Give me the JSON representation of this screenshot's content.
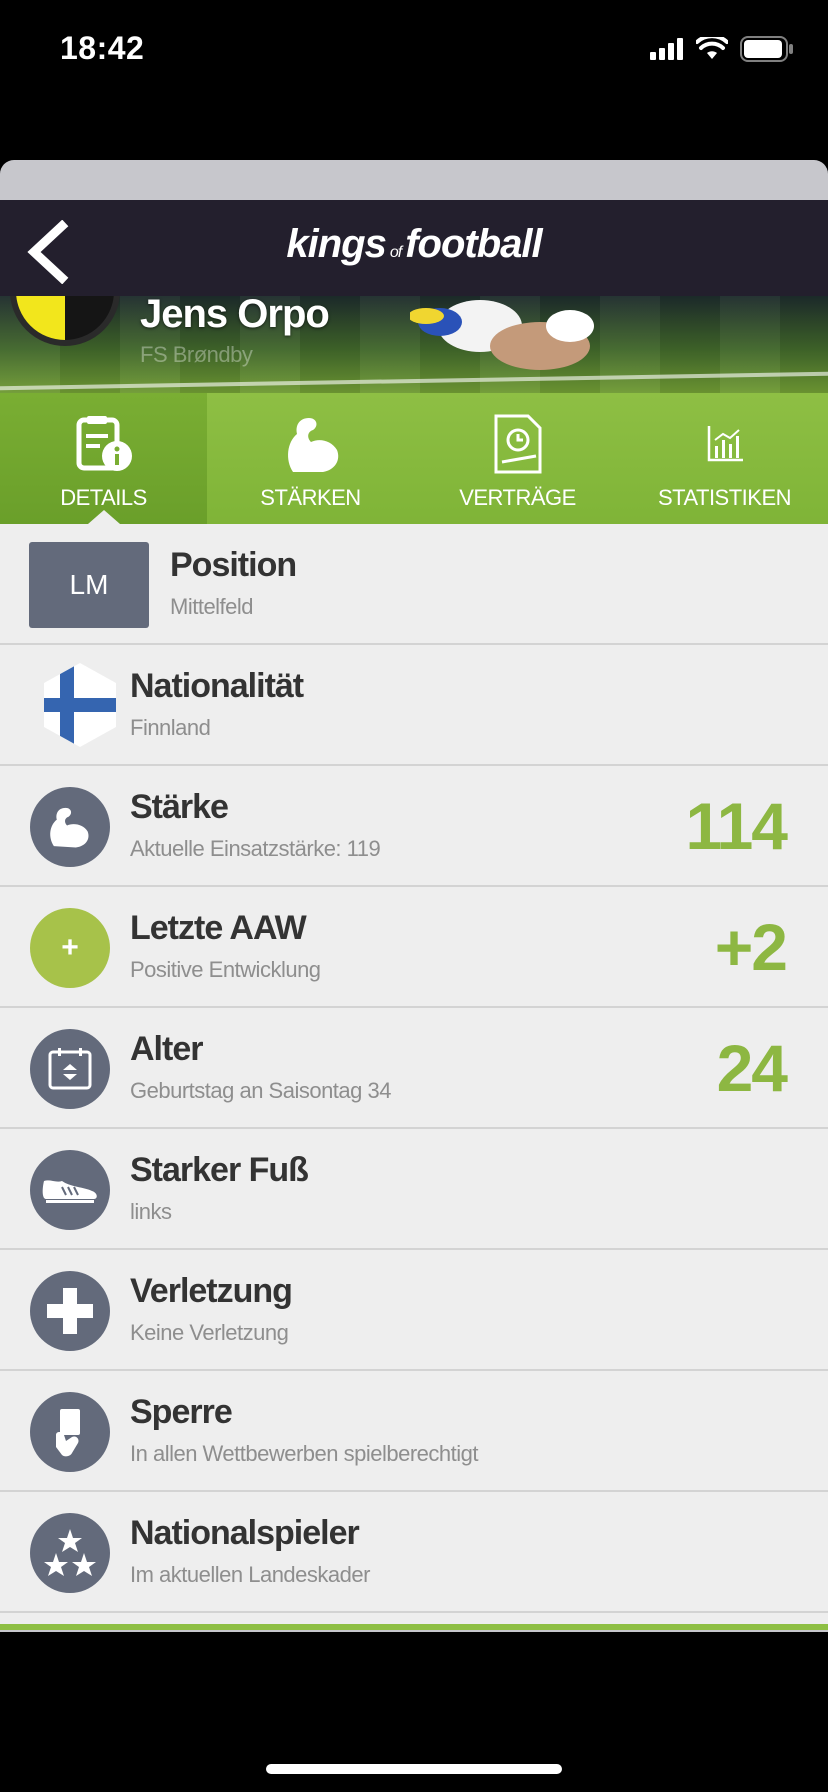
{
  "status": {
    "time": "18:42"
  },
  "app": {
    "logo_left": "kings",
    "logo_of": "of",
    "logo_right": "football"
  },
  "player": {
    "name": "Jens Orpo",
    "club": "FS Brøndby"
  },
  "tabs": [
    {
      "label": "DETAILS",
      "icon": "document-info-icon",
      "active": true
    },
    {
      "label": "STÄRKEN",
      "icon": "muscle-arm-icon"
    },
    {
      "label": "VERTRÄGE",
      "icon": "contract-clock-icon"
    },
    {
      "label": "STATISTIKEN",
      "icon": "bar-chart-icon"
    }
  ],
  "details": {
    "position": {
      "badge": "LM",
      "title": "Position",
      "subtitle": "Mittelfeld"
    },
    "nationality": {
      "title": "Nationalität",
      "subtitle": "Finnland",
      "icon": "finland-flag-icon"
    },
    "strength": {
      "title": "Stärke",
      "subtitle": "Aktuelle Einsatzstärke: 119",
      "value": "114",
      "icon": "muscle-arm-icon"
    },
    "last_aaw": {
      "title": "Letzte AAW",
      "subtitle": "Positive Entwicklung",
      "value": "+2",
      "icon_text": "+"
    },
    "age": {
      "title": "Alter",
      "subtitle": "Geburtstag an Saisontag 34",
      "value": "24",
      "icon": "calendar-icon"
    },
    "foot": {
      "title": "Starker Fuß",
      "subtitle": "links",
      "icon": "football-boot-icon"
    },
    "injury": {
      "title": "Verletzung",
      "subtitle": "Keine Verletzung",
      "icon": "medical-cross-icon"
    },
    "suspension": {
      "title": "Sperre",
      "subtitle": "In allen Wettbewerben spielberechtigt",
      "icon": "referee-card-icon"
    },
    "national": {
      "title": "Nationalspieler",
      "subtitle": "Im aktuellen Landeskader",
      "icon": "three-stars-icon"
    }
  },
  "colors": {
    "accent_green": "#8db742",
    "icon_gray": "#636a7b",
    "nav_dark": "#231f2d"
  }
}
